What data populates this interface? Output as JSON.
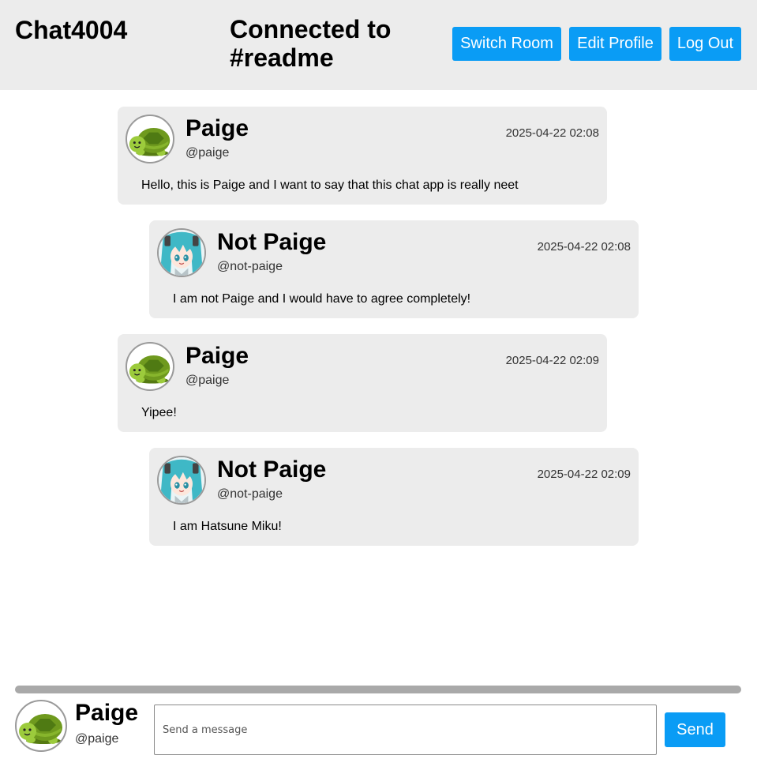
{
  "header": {
    "app_title": "Chat4004",
    "room_line1": "Connected to",
    "room_line2": "#readme",
    "buttons": {
      "switch_room": "Switch Room",
      "edit_profile": "Edit Profile",
      "log_out": "Log Out"
    }
  },
  "messages": [
    {
      "name": "Paige",
      "handle": "@paige",
      "time": "2025-04-22 02:08",
      "text": "Hello, this is Paige and I want to say that this chat app is really neet",
      "avatar": "turtle-avatar"
    },
    {
      "name": "Not Paige",
      "handle": "@not-paige",
      "time": "2025-04-22 02:08",
      "text": "I am not Paige and I would have to agree completely!",
      "avatar": "anime-girl-avatar"
    },
    {
      "name": "Paige",
      "handle": "@paige",
      "time": "2025-04-22 02:09",
      "text": "Yipee!",
      "avatar": "turtle-avatar"
    },
    {
      "name": "Not Paige",
      "handle": "@not-paige",
      "time": "2025-04-22 02:09",
      "text": "I am Hatsune Miku!",
      "avatar": "anime-girl-avatar"
    }
  ],
  "composer": {
    "name": "Paige",
    "handle": "@paige",
    "placeholder": "Send a message",
    "value": "",
    "send_label": "Send"
  },
  "colors": {
    "header_bg": "#ececec",
    "button_bg": "#0a9cf5",
    "message_bg": "#ececec"
  }
}
